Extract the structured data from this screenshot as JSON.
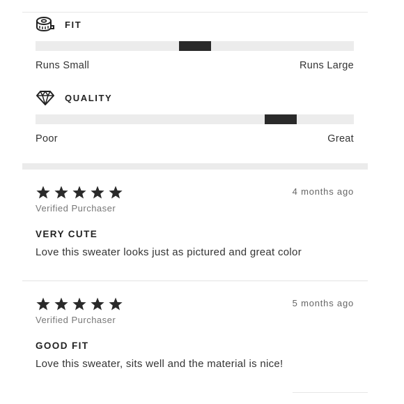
{
  "metrics": [
    {
      "title": "FIT",
      "icon": "tape-measure-icon",
      "low_label": "Runs Small",
      "high_label": "Runs Large",
      "value_fraction": 0.5
    },
    {
      "title": "QUALITY",
      "icon": "diamond-icon",
      "low_label": "Poor",
      "high_label": "Great",
      "value_fraction": 0.77
    }
  ],
  "reviews": [
    {
      "rating": 5,
      "date": "4 months ago",
      "verified": "Verified Purchaser",
      "title": "VERY CUTE",
      "body": "Love this sweater looks just as pictured and great color"
    },
    {
      "rating": 5,
      "date": "5 months ago",
      "verified": "Verified Purchaser",
      "title": "GOOD FIT",
      "body": "Love this sweater, sits well and the material is nice!"
    }
  ],
  "colors": {
    "marker": "#2a2a2a",
    "track": "#ececec",
    "star": "#2a2a2a"
  }
}
